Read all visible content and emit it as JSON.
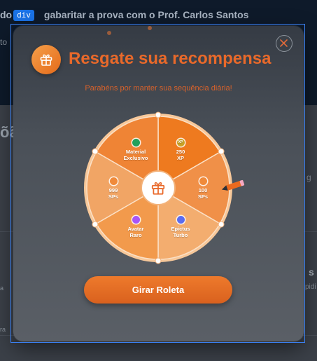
{
  "background": {
    "header_prefix": "do",
    "header_text": "gabaritar a prova com o Prof. Carlos Santos",
    "side_left_text": "to",
    "big_left_text": "õã",
    "side_right_small": "g",
    "side_right_s": "s",
    "side_right_pid": "pidi",
    "left_small_a": "a",
    "left_small_ra": "ra"
  },
  "devtools": {
    "tag": "div"
  },
  "modal": {
    "title": "Resgate sua recompensa",
    "subtitle": "Parabéns por manter sua sequência diária!",
    "spin_button": "Girar Roleta"
  },
  "wheel": {
    "segments": [
      {
        "label_line1": "250",
        "label_line2": "XP",
        "icon": "xp-coin-icon",
        "icon_text": "XP",
        "icon_color": "#c9a227",
        "fill": "#ee7a1f"
      },
      {
        "label_line1": "100",
        "label_line2": "SPs",
        "icon": "sp-coin-icon",
        "icon_text": "",
        "icon_color": "#f08a3a",
        "fill": "#f09048"
      },
      {
        "label_line1": "Epictus",
        "label_line2": "Turbo",
        "icon": "turbo-icon",
        "icon_text": "",
        "icon_color": "#5b6cf0",
        "fill": "#f3ad6f"
      },
      {
        "label_line1": "Avatar",
        "label_line2": "Raro",
        "icon": "avatar-icon",
        "icon_text": "",
        "icon_color": "#a855f7",
        "fill": "#f29a4c"
      },
      {
        "label_line1": "999",
        "label_line2": "SPs",
        "icon": "sp-coin-icon",
        "icon_text": "",
        "icon_color": "#f08a3a",
        "fill": "#f1a565"
      },
      {
        "label_line1": "Material",
        "label_line2": "Exclusivo",
        "icon": "material-icon",
        "icon_text": "",
        "icon_color": "#22a05b",
        "fill": "#ef8435"
      }
    ],
    "center_icon": "gift-icon"
  },
  "colors": {
    "accent": "#e9692a",
    "modal_bg": "#4a5058"
  }
}
